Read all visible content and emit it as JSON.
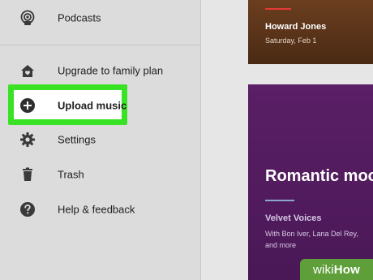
{
  "sidebar": {
    "items": [
      {
        "label": "Podcasts",
        "icon": "podcast-icon"
      },
      {
        "label": "Upgrade to family plan",
        "icon": "family-home-icon"
      },
      {
        "label": "Upload music",
        "icon": "add-circle-icon",
        "highlighted": true
      },
      {
        "label": "Settings",
        "icon": "gear-icon"
      },
      {
        "label": "Trash",
        "icon": "trash-icon"
      },
      {
        "label": "Help & feedback",
        "icon": "help-icon"
      }
    ]
  },
  "main": {
    "cards": [
      {
        "accent": "#e53935",
        "title": "Howard Jones",
        "subtitle": "Saturday, Feb 1"
      },
      {
        "title": "Romantic moo",
        "artist": "Velvet Voices",
        "description": "With Bon Iver, Lana Del Rey, and more",
        "accent": "#90a4d4"
      }
    ]
  },
  "watermark": {
    "part1": "wiki",
    "part2": "How"
  },
  "colors": {
    "highlight": "#39e224",
    "watermark_bg": "#5f9f3a"
  }
}
